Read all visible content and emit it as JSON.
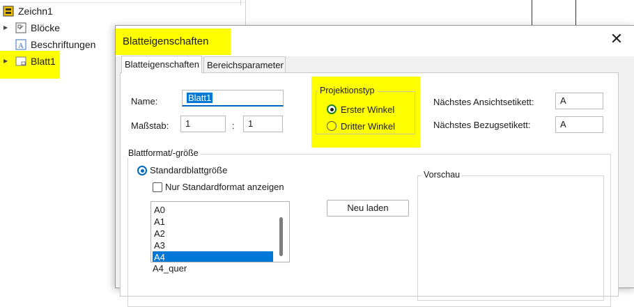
{
  "tree": {
    "items": [
      {
        "label": "Zeichn1",
        "icon": "drawing-icon"
      },
      {
        "label": "Blöcke",
        "icon": "blocks-icon"
      },
      {
        "label": "Beschriftungen",
        "icon": "annotations-icon"
      },
      {
        "label": "Blatt1",
        "icon": "sheet-icon"
      }
    ]
  },
  "dialog": {
    "title": "Blatteigenschaften",
    "close_symbol": "✕",
    "tabs": [
      {
        "label": "Blatteigenschaften",
        "active": true
      },
      {
        "label": "Bereichsparameter",
        "active": false
      }
    ],
    "name_label": "Name:",
    "name_value": "Blatt1",
    "scale_label": "Maßstab:",
    "scale_left": "1",
    "scale_separator": ":",
    "scale_right": "1",
    "projection": {
      "title": "Projektionstyp",
      "options": [
        {
          "label": "Erster Winkel",
          "selected": true
        },
        {
          "label": "Dritter Winkel",
          "selected": false
        }
      ]
    },
    "next_view_label": "Nächstes Ansichtsetikett:",
    "next_view_value": "A",
    "next_datum_label": "Nächstes Bezugsetikett:",
    "next_datum_value": "A",
    "sheet_format": {
      "title": "Blattformat/-größe",
      "standard_label": "Standardblattgröße",
      "standard_selected": true,
      "only_standard_label": "Nur Standardformat anzeigen",
      "only_standard_checked": false,
      "sizes": [
        "A0",
        "A1",
        "A2",
        "A3",
        "A4",
        "A4_quer"
      ],
      "selected_size": "A4",
      "reload_label": "Neu laden"
    },
    "preview_title": "Vorschau"
  },
  "colors": {
    "highlight": "#ffff00",
    "accent": "#0078d7",
    "radio_green": "#1a7f1a"
  }
}
